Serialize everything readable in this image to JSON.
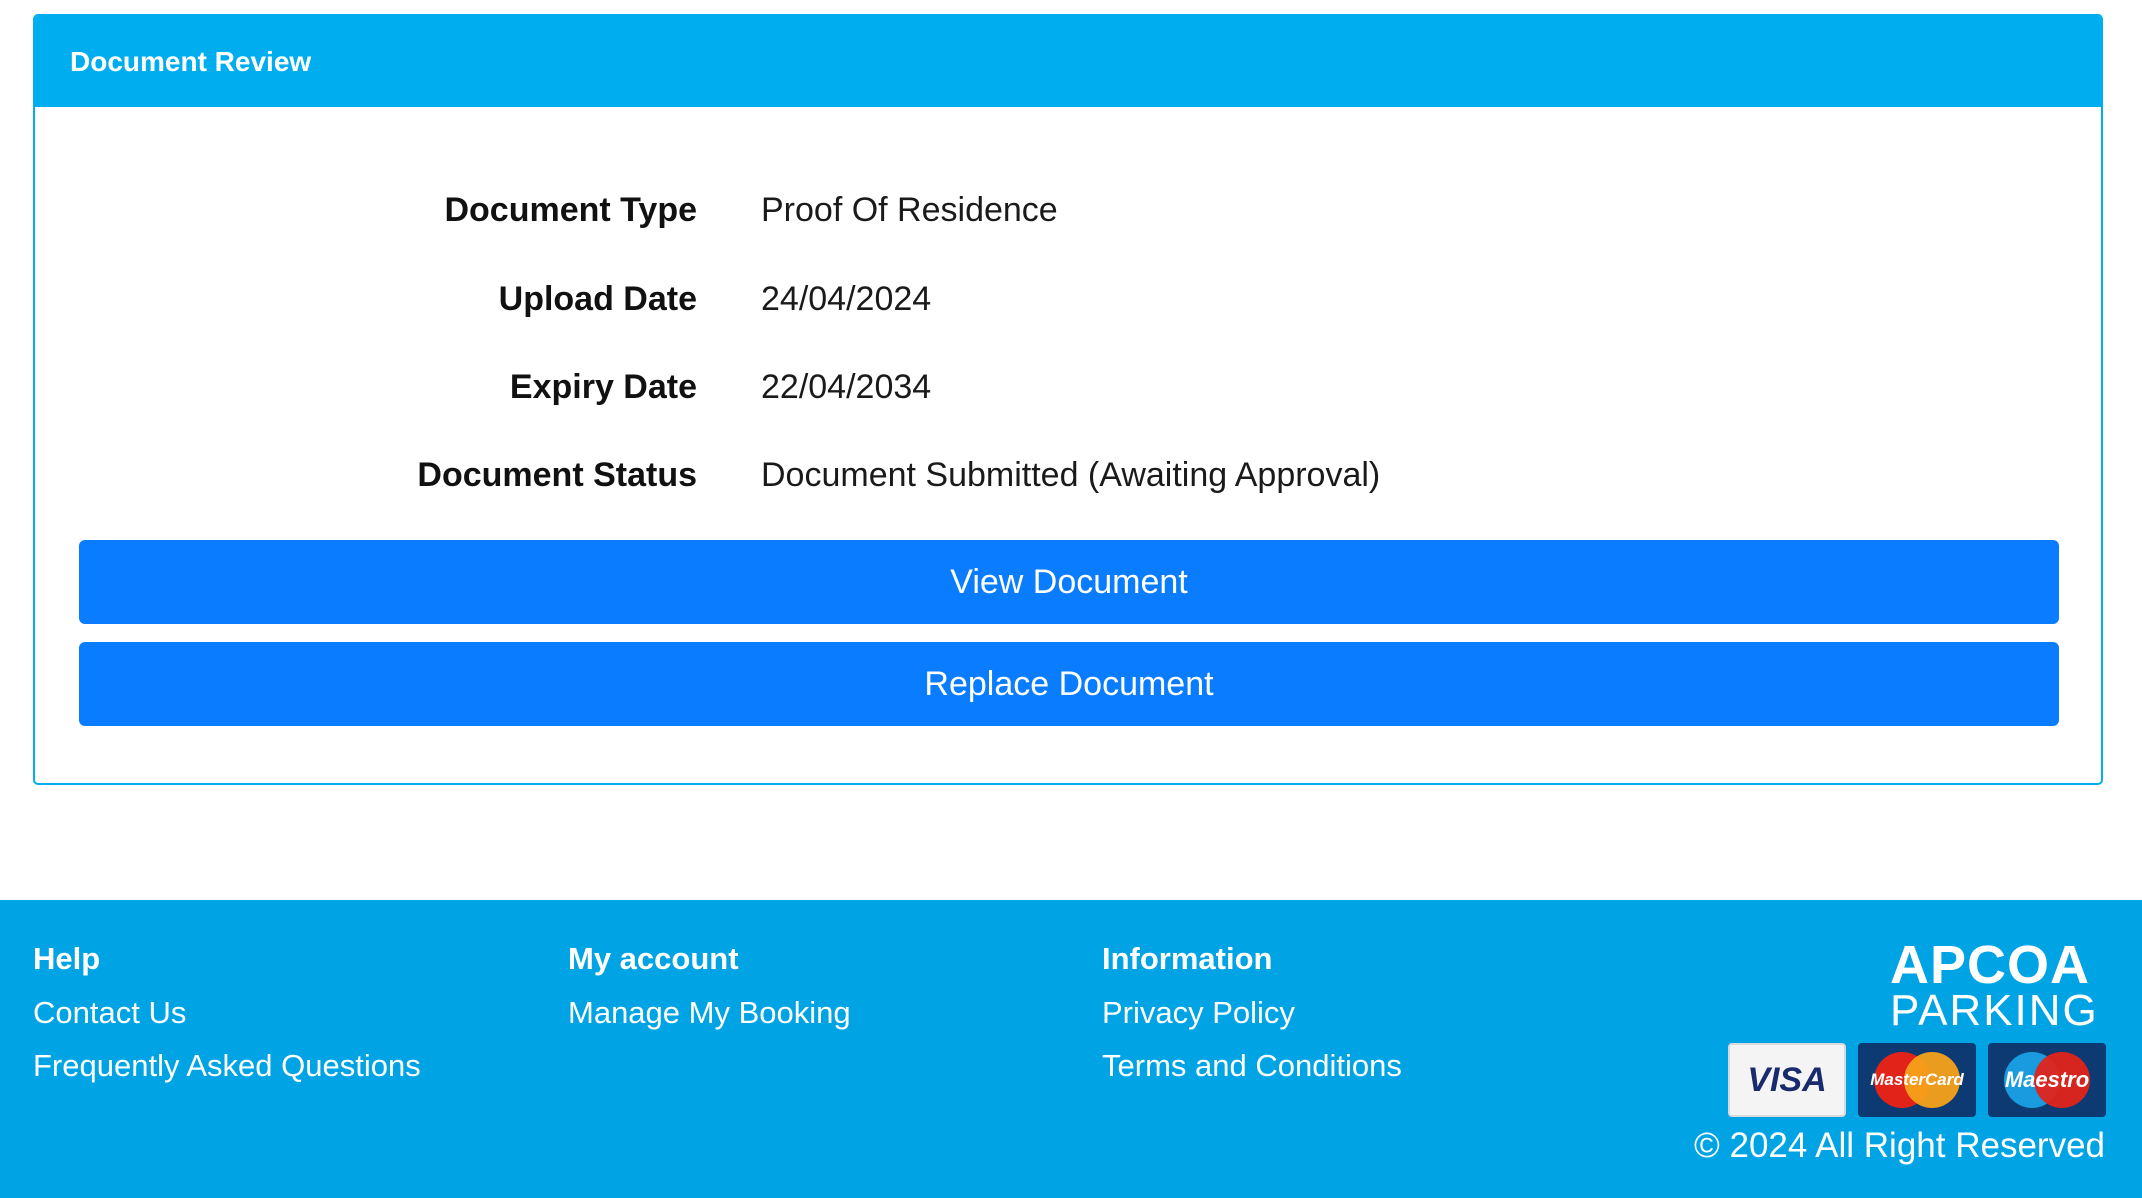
{
  "card": {
    "title": "Document Review",
    "details": [
      {
        "label": "Document Type",
        "value": "Proof Of Residence"
      },
      {
        "label": "Upload Date",
        "value": "24/04/2024"
      },
      {
        "label": "Expiry Date",
        "value": "22/04/2034"
      },
      {
        "label": "Document Status",
        "value": "Document Submitted (Awaiting Approval)"
      }
    ],
    "view_button": "View Document",
    "replace_button": "Replace Document"
  },
  "footer": {
    "help": {
      "heading": "Help",
      "links": [
        "Contact Us",
        "Frequently Asked Questions"
      ]
    },
    "account": {
      "heading": "My account",
      "links": [
        "Manage My Booking"
      ]
    },
    "information": {
      "heading": "Information",
      "links": [
        "Privacy Policy",
        "Terms and Conditions"
      ]
    },
    "logo": {
      "line1": "APCOA",
      "line2": "PARKING"
    },
    "payment_cards": {
      "visa": "VISA",
      "mastercard": "MasterCard",
      "maestro": "Maestro"
    },
    "copyright": "© 2024 All Right Reserved"
  },
  "colors": {
    "header_blue": "#00aeef",
    "button_blue": "#0a7cff",
    "footer_blue": "#00a3e3"
  }
}
